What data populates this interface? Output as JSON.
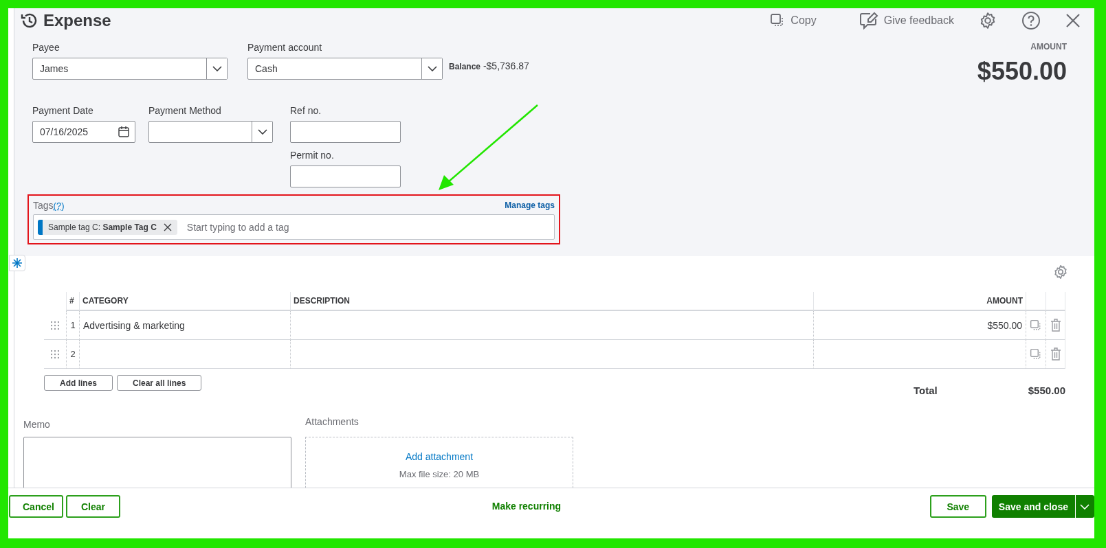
{
  "header": {
    "title": "Expense",
    "actions": [
      {
        "label": "Copy"
      },
      {
        "label": "Give feedback"
      }
    ]
  },
  "payee": {
    "label": "Payee",
    "value": "James"
  },
  "payment_account": {
    "label": "Payment account",
    "value": "Cash",
    "balance_label": "Balance",
    "balance": "-$5,736.87"
  },
  "amount": {
    "label": "AMOUNT",
    "value": "$550.00"
  },
  "payment_date": {
    "label": "Payment Date",
    "value": "07/16/2025"
  },
  "payment_method": {
    "label": "Payment Method"
  },
  "ref_no": {
    "label": "Ref no."
  },
  "permit_no": {
    "label": "Permit no."
  },
  "tags": {
    "label": "Tags",
    "help": "(?)",
    "manage_link": "Manage tags",
    "placeholder": "Start typing to add a tag",
    "items": [
      {
        "text": "Sample tag C: **Sample Tag C**",
        "color": "#0077c5"
      }
    ]
  },
  "table": {
    "columns": [
      "#",
      "CATEGORY",
      "DESCRIPTION",
      "AMOUNT"
    ],
    "rows": [
      {
        "number": "1",
        "category": "Advertising & marketing",
        "amount": "$550.00"
      },
      {
        "number": "2"
      }
    ]
  },
  "table_buttons": [
    "Add lines",
    "Clear all lines"
  ],
  "total": {
    "label": "Total",
    "value": "$550.00"
  },
  "memo": {
    "label": "Memo"
  },
  "attachments": {
    "label": "Attachments",
    "link": "Add attachment",
    "note": "Max file size: 20 MB"
  },
  "footer": {
    "left_buttons": [
      "Cancel",
      "Clear"
    ],
    "center_link": "Make recurring",
    "save": "Save",
    "save_close": "Save and close"
  }
}
